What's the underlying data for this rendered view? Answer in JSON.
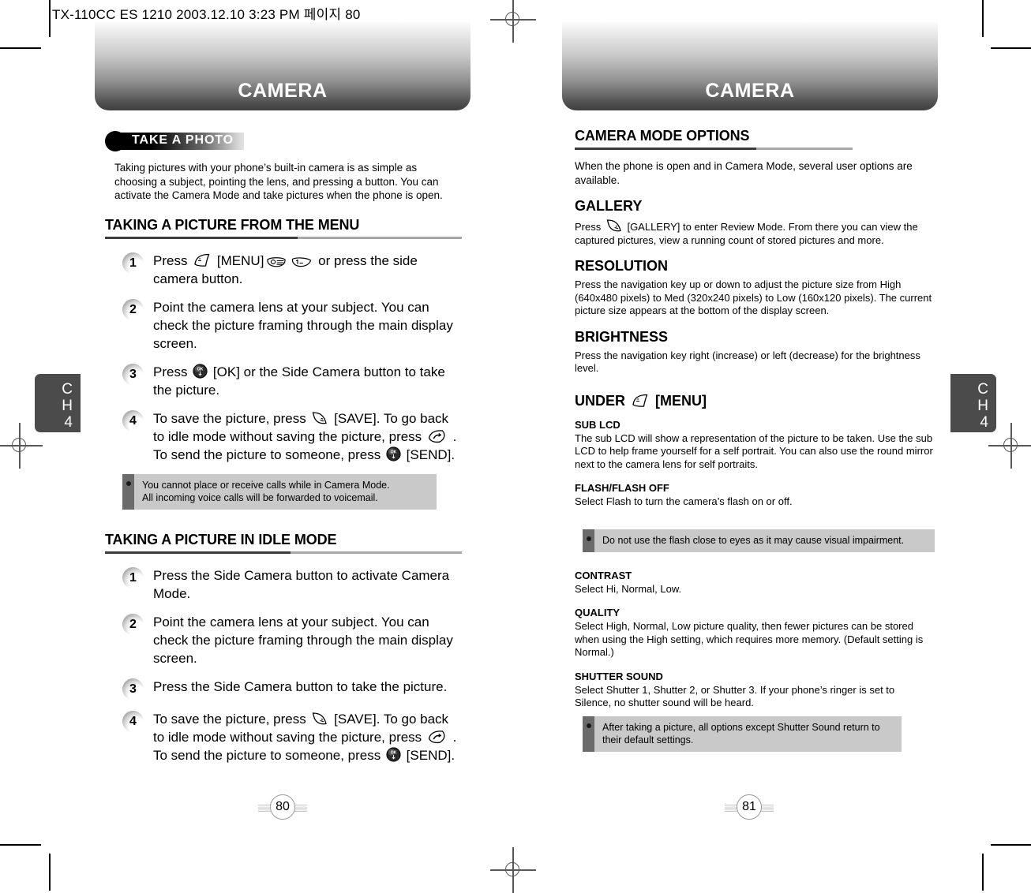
{
  "doc": {
    "slug": "TX-110CC ES 1210  2003.12.10 3:23 PM 페이지 80"
  },
  "chapter_tab": {
    "c": "C",
    "h": "H",
    "num": "4"
  },
  "left_page": {
    "banner_title": "CAMERA",
    "page_number": "80",
    "badge": "TAKE A PHOTO",
    "intro": "Taking pictures with your phone’s built-in camera is as simple as choosing a subject, pointing the lens, and pressing a button.  You can activate the Camera Mode and take pictures when the phone is open.",
    "section1": {
      "heading": "TAKING A PICTURE FROM THE MENU",
      "steps": [
        {
          "num": "1",
          "parts": [
            {
              "t": "text",
              "v": "Press "
            },
            {
              "t": "icon",
              "v": "softkey-left-icon"
            },
            {
              "t": "text",
              "v": " [MENU]"
            },
            {
              "t": "icon",
              "v": "key-0-icon"
            },
            {
              "t": "icon",
              "v": "key-1-icon"
            },
            {
              "t": "text",
              "v": " or press the side camera button."
            }
          ]
        },
        {
          "num": "2",
          "parts": [
            {
              "t": "text",
              "v": "Point the camera lens at your subject. You can check the picture framing through the main display screen."
            }
          ]
        },
        {
          "num": "3",
          "parts": [
            {
              "t": "text",
              "v": "Press "
            },
            {
              "t": "icon",
              "v": "ok-key-icon"
            },
            {
              "t": "text",
              "v": " [OK] or the Side Camera button to take the picture."
            }
          ]
        },
        {
          "num": "4",
          "parts": [
            {
              "t": "text",
              "v": "To save the picture, press "
            },
            {
              "t": "icon",
              "v": "softkey-right-icon"
            },
            {
              "t": "text",
              "v": " [SAVE].  To go back to idle mode without saving the picture, press "
            },
            {
              "t": "icon",
              "v": "end-key-icon"
            },
            {
              "t": "text",
              "v": " .  To send the picture to someone, press "
            },
            {
              "t": "icon",
              "v": "ok-key-icon"
            },
            {
              "t": "text",
              "v": " [SEND]."
            }
          ]
        }
      ],
      "note": "You cannot place or receive calls while in Camera Mode.\nAll incoming voice calls will be forwarded to voicemail."
    },
    "section2": {
      "heading": "TAKING A PICTURE IN IDLE MODE",
      "steps": [
        {
          "num": "1",
          "parts": [
            {
              "t": "text",
              "v": "Press the Side Camera button to activate Camera Mode."
            }
          ]
        },
        {
          "num": "2",
          "parts": [
            {
              "t": "text",
              "v": "Point the camera lens at your subject. You can check the picture framing through the main display screen."
            }
          ]
        },
        {
          "num": "3",
          "parts": [
            {
              "t": "text",
              "v": "Press the Side Camera button to take the picture."
            }
          ]
        },
        {
          "num": "4",
          "parts": [
            {
              "t": "text",
              "v": "To save the picture, press "
            },
            {
              "t": "icon",
              "v": "softkey-right-icon"
            },
            {
              "t": "text",
              "v": " [SAVE].  To go back to idle mode without saving the picture, press "
            },
            {
              "t": "icon",
              "v": "end-key-icon"
            },
            {
              "t": "text",
              "v": " .  To send the picture to someone, press "
            },
            {
              "t": "icon",
              "v": "ok-key-icon"
            },
            {
              "t": "text",
              "v": " [SEND]."
            }
          ]
        }
      ]
    }
  },
  "right_page": {
    "banner_title": "CAMERA",
    "page_number": "81",
    "section_heading": "CAMERA MODE OPTIONS",
    "intro": "When the phone is open and in Camera Mode, several user options are available.",
    "gallery": {
      "heading": "GALLERY",
      "parts": [
        {
          "t": "text",
          "v": "Press "
        },
        {
          "t": "icon",
          "v": "softkey-right-icon"
        },
        {
          "t": "text",
          "v": " [GALLERY] to enter Review Mode. From there you can view the captured pictures, view a running count of stored pictures and more."
        }
      ]
    },
    "resolution": {
      "heading": "RESOLUTION",
      "body": "Press the navigation key up or down to adjust the picture size from High (640x480 pixels) to Med (320x240 pixels) to Low (160x120 pixels). The current picture size appears at the bottom of the display screen."
    },
    "brightness": {
      "heading": "BRIGHTNESS",
      "body": "Press the navigation key right (increase) or left (decrease) for the brightness level."
    },
    "under_menu": {
      "heading_pre": "UNDER ",
      "heading_icon": "softkey-left-icon",
      "heading_post": " [MENU]"
    },
    "sub_lcd": {
      "heading": "SUB LCD",
      "body": "The sub LCD will show a representation of the picture to be taken.  Use the sub LCD to help frame yourself for a self portrait.  You can also use the round mirror next to the camera lens for self portraits."
    },
    "flash": {
      "heading": "FLASH/FLASH OFF",
      "body": "Select Flash to turn the camera’s flash on or off."
    },
    "flash_note": "Do not use the flash close to eyes as it may cause visual impairment.",
    "contrast": {
      "heading": "CONTRAST",
      "body": "Select Hi, Normal, Low."
    },
    "quality": {
      "heading": "QUALITY",
      "body": "Select High, Normal, Low picture quality, then fewer pictures can be stored when using the High setting, which requires more memory. (Default setting is Normal.)"
    },
    "shutter_sound": {
      "heading": "SHUTTER SOUND",
      "body": "Select Shutter 1, Shutter 2, or Shutter 3. If your phone’s ringer is set to Silence, no shutter sound will be heard."
    },
    "shutter_note": "After taking a picture, all options except Shutter Sound return to their default settings."
  }
}
